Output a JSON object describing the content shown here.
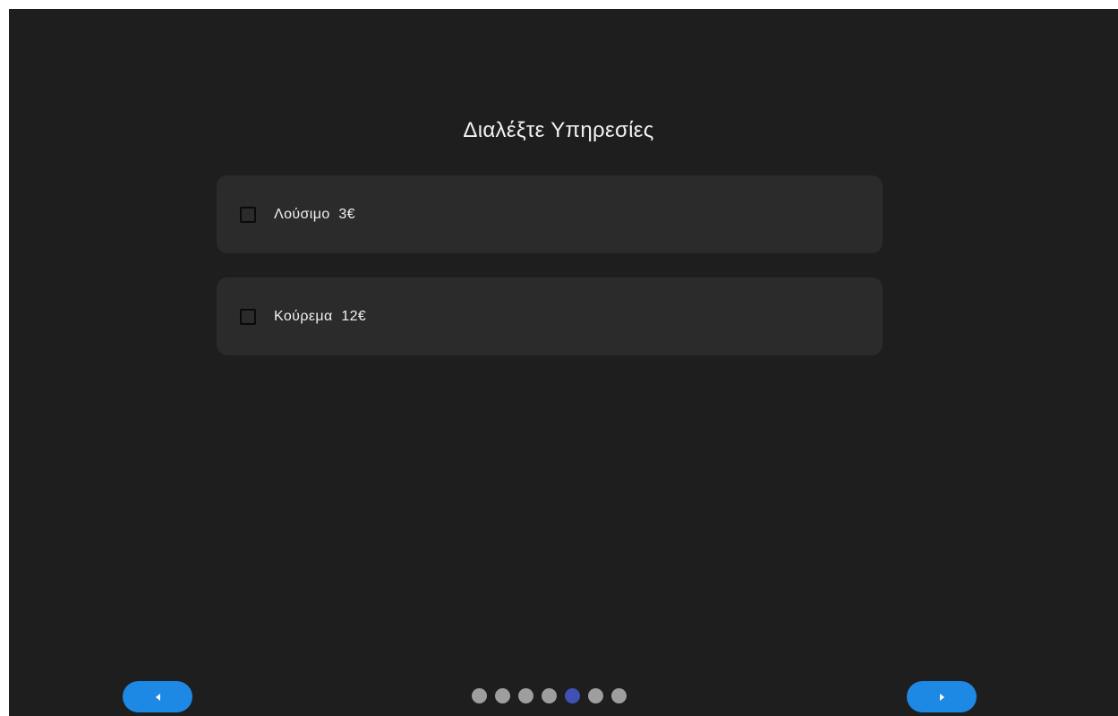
{
  "header": {
    "title": "Διαλέξτε Υπηρεσίες"
  },
  "services": [
    {
      "label": "Λούσιμο  3€",
      "checked": false
    },
    {
      "label": "Κούρεμα  12€",
      "checked": false
    }
  ],
  "navigation": {
    "prev_icon": "chevron-left-icon",
    "next_icon": "chevron-right-icon"
  },
  "pager": {
    "total": 7,
    "current": 5
  },
  "colors": {
    "background": "#1e1e1e",
    "card": "#2b2b2b",
    "accent": "#1e88e5",
    "active_dot": "#3f51b5",
    "inactive_dot": "#9e9e9e"
  }
}
